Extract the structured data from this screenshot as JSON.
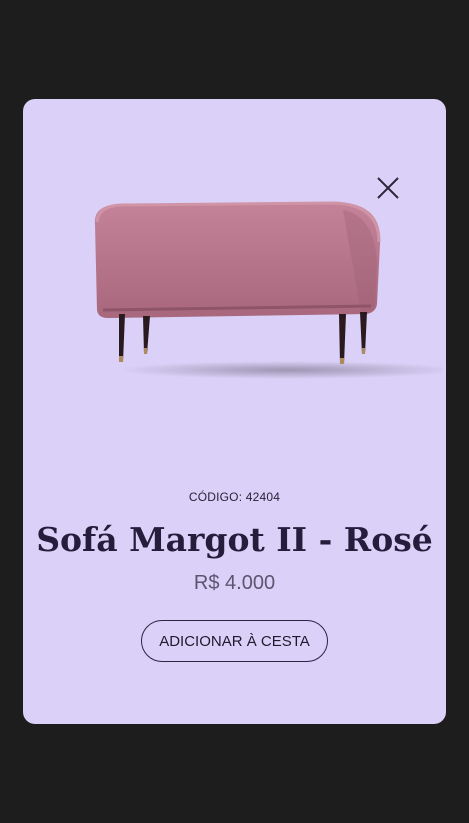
{
  "modal": {
    "close_icon": "close-icon",
    "product_image_alt": "sofa-image",
    "code_label": "CÓDIGO:",
    "code_value": "42404",
    "title": "Sofá Margot II - Rosé",
    "price": "R$ 4.000",
    "add_button_label": "ADICIONAR À CESTA"
  },
  "colors": {
    "backdrop": "#1d1d1d",
    "modal_bg": "#dbd0f7",
    "title": "#251d3c",
    "price": "#5a5670",
    "sofa": "#b7768c"
  }
}
